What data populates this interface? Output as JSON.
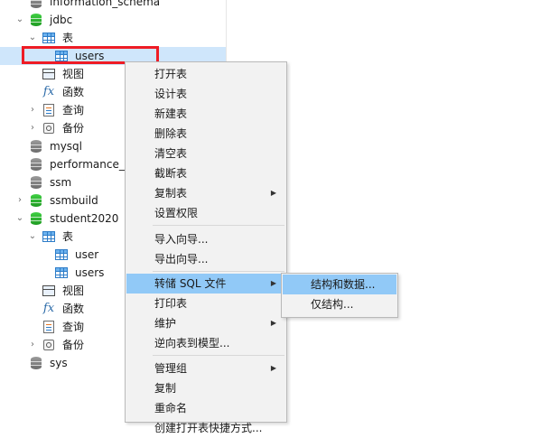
{
  "tree": {
    "top_partial": "information_schema",
    "jdbc": {
      "name": "jdbc",
      "tables_group": "表",
      "table": "users",
      "views": "视图",
      "functions": "函数",
      "queries": "查询",
      "backups": "备份"
    },
    "databases": [
      "mysql",
      "performance_",
      "ssm",
      "ssmbuild"
    ],
    "student2020": {
      "name": "student2020",
      "tables_group": "表",
      "tables": [
        "user",
        "users"
      ],
      "views": "视图",
      "functions": "函数",
      "queries": "查询",
      "backups": "备份"
    },
    "sys": "sys"
  },
  "context_menu": {
    "items": [
      "打开表",
      "设计表",
      "新建表",
      "删除表",
      "清空表",
      "截断表",
      "复制表",
      "设置权限",
      "导入向导...",
      "导出向导...",
      "转储 SQL 文件",
      "打印表",
      "维护",
      "逆向表到模型...",
      "管理组",
      "复制",
      "重命名",
      "创建打开表快捷方式..."
    ]
  },
  "submenu": {
    "items": [
      "结构和数据...",
      "仅结构..."
    ]
  },
  "icons": {
    "db": "database-icon",
    "table": "table-icon",
    "view": "view-icon",
    "function": "fx-icon",
    "query": "query-icon",
    "backup": "backup-icon"
  }
}
